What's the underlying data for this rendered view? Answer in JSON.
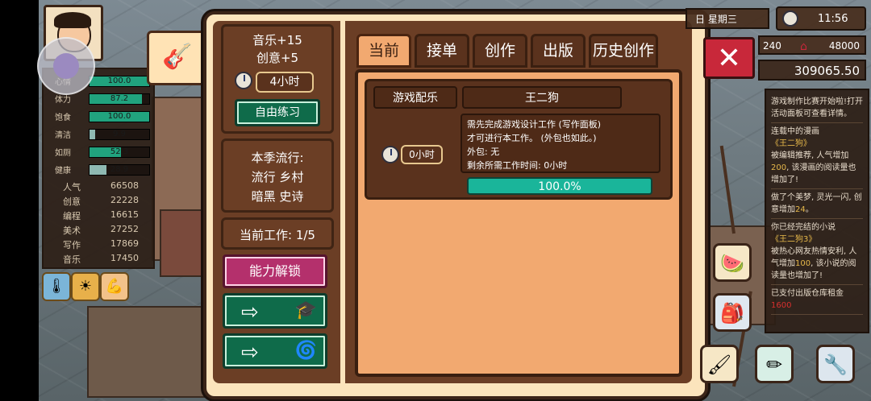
{
  "left_panel": {
    "bars": [
      {
        "label": "心情",
        "value": "100.0",
        "fraction": 1.0,
        "color": "#21a37e"
      },
      {
        "label": "体力",
        "value": "87.2",
        "fraction": 0.872,
        "color": "#21a37e"
      },
      {
        "label": "饱食",
        "value": "100.0",
        "fraction": 1.0,
        "color": "#21a37e"
      },
      {
        "label": "清洁",
        "value": "9.9",
        "fraction": 0.099,
        "color": "#8fb9b2"
      },
      {
        "label": "如厕",
        "value": "52.3",
        "fraction": 0.523,
        "color": "#21a37e"
      },
      {
        "label": "健康",
        "value": "28.9",
        "fraction": 0.289,
        "color": "#8fb9b2"
      }
    ],
    "attributes": [
      {
        "name": "人气",
        "value": "66508"
      },
      {
        "name": "创意",
        "value": "22228"
      },
      {
        "name": "编程",
        "value": "16615"
      },
      {
        "name": "美术",
        "value": "27252"
      },
      {
        "name": "写作",
        "value": "17869"
      },
      {
        "name": "音乐",
        "value": "17450"
      }
    ],
    "status_icons": [
      "thermometer-icon",
      "sun-icon",
      "arm-icon"
    ]
  },
  "sidebar": {
    "bonus_music": "音乐+15",
    "bonus_creativity": "创意+5",
    "practice_time": "4小时",
    "free_practice": "自由练习",
    "trend_title": "本季流行:",
    "trend_line1": "流行 乡村",
    "trend_line2": "暗黑 史诗",
    "current_jobs": "当前工作:  1/5",
    "unlock_button": "能力解锁"
  },
  "tabs": [
    {
      "label": "当前",
      "active": true
    },
    {
      "label": "接单",
      "active": false
    },
    {
      "label": "创作",
      "active": false
    },
    {
      "label": "出版",
      "active": false
    },
    {
      "label": "历史创作",
      "active": false
    }
  ],
  "job": {
    "type": "游戏配乐",
    "name": "王二狗",
    "time": "0小时",
    "desc_line1": "需先完成游戏设计工作 (写作面板)",
    "desc_line2": "才可进行本工作。 (外包也如此。)",
    "desc_line3": "外包: 无",
    "desc_line4": "剩余所需工作时间: 0小时",
    "progress_text": "100.0%",
    "progress": 1.0
  },
  "hud": {
    "date": "日 星期三",
    "clock": "11:56",
    "res_left": "240",
    "res_right": "48000",
    "money": "309065.50"
  },
  "log": {
    "e1": "游戏制作比赛开始啦!打开活动面板可查看详情。",
    "e2a": "连载中的漫画",
    "e2b": "《王二狗》",
    "e2c": "被编辑推荐, 人气增加",
    "e2d": "200",
    "e2e": ", 该漫画的阅读量也增加了!",
    "e3a": "做了个美梦, 灵光一闪, 创意增加",
    "e3b": "24",
    "e3c": "。",
    "e4a": "你已经完结的小说",
    "e4b": "《王二狗3》",
    "e4c": "被热心网友热情安利, 人气增加",
    "e4d": "100",
    "e4e": ", 该小说的阅读量也增加了!",
    "e5a": "已支付出版仓库租金",
    "e5b": "1600"
  },
  "colors": {
    "dialog_bg": "#fbe4bc",
    "panel_brown": "#6b3e25",
    "tab_active": "#f2a970",
    "green_button": "#0f6b4a",
    "pink_button": "#b4306c",
    "progress": "#1ab59a",
    "close_red": "#c8283a"
  }
}
